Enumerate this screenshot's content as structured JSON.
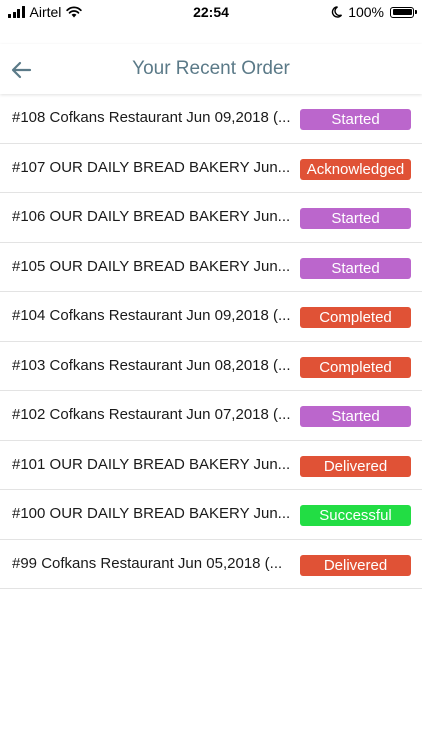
{
  "status_bar": {
    "carrier": "Airtel",
    "time": "22:54",
    "battery": "100%"
  },
  "header": {
    "title": "Your Recent Order",
    "back_icon": "arrow-left-icon"
  },
  "status_colors": {
    "Started": "#bb66cc",
    "Acknowledged": "#e05236",
    "Completed": "#e05236",
    "Delivered": "#e05236",
    "Successful": "#22dd44"
  },
  "orders": [
    {
      "text": "#108 Cofkans Restaurant Jun 09,2018 (...",
      "status": "Started"
    },
    {
      "text": "#107 OUR DAILY BREAD BAKERY Jun...",
      "status": "Acknowledged"
    },
    {
      "text": "#106 OUR DAILY BREAD BAKERY Jun...",
      "status": "Started"
    },
    {
      "text": "#105 OUR DAILY BREAD BAKERY Jun...",
      "status": "Started"
    },
    {
      "text": "#104 Cofkans Restaurant Jun 09,2018 (...",
      "status": "Completed"
    },
    {
      "text": "#103 Cofkans Restaurant Jun 08,2018 (...",
      "status": "Completed"
    },
    {
      "text": "#102 Cofkans Restaurant Jun 07,2018 (...",
      "status": "Started"
    },
    {
      "text": "#101 OUR DAILY BREAD BAKERY Jun...",
      "status": "Delivered"
    },
    {
      "text": "#100 OUR DAILY BREAD BAKERY Jun...",
      "status": "Successful"
    },
    {
      "text": "#99 Cofkans Restaurant Jun 05,2018 (...",
      "status": "Delivered"
    }
  ]
}
